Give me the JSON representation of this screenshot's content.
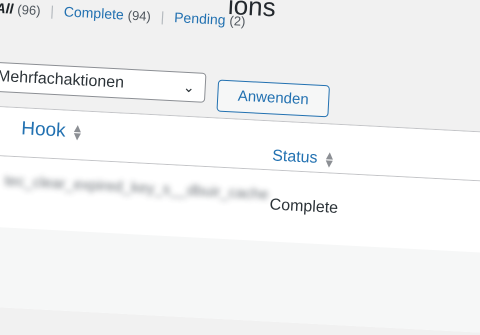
{
  "page": {
    "title_fragment": "ions"
  },
  "filters": {
    "all": {
      "label": "All",
      "count": "(96)"
    },
    "complete": {
      "label": "Complete",
      "count": "(94)"
    },
    "pending": {
      "label": "Pending",
      "count": "(2)"
    },
    "separator": "|"
  },
  "bulk_actions": {
    "selected": "Mehrfachaktionen",
    "apply_label": "Anwenden"
  },
  "table": {
    "columns": {
      "hook": "Hook",
      "status": "Status"
    },
    "rows": [
      {
        "hook": "tec_clear_expired_key_s__dbuir_cache",
        "status": "Complete"
      }
    ]
  },
  "icons": {
    "sort": "sort-arrows-icon",
    "dropdown": "chevron-down-icon"
  }
}
